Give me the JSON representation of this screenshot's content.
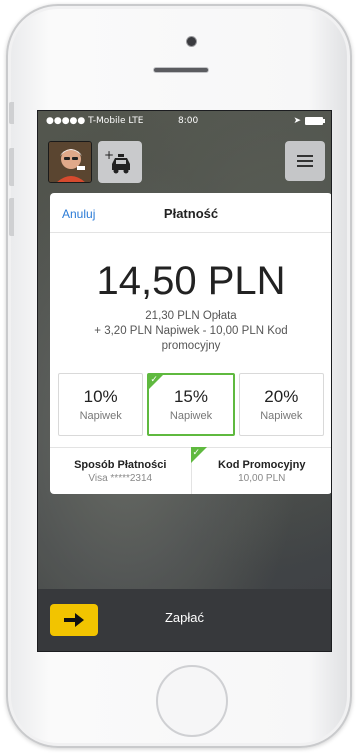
{
  "status_bar": {
    "carrier": "●●●●● T-Mobile LTE",
    "time": "8:00"
  },
  "header": {
    "avatar_icon": "driver-avatar",
    "taxi_icon": "add-taxi-icon",
    "menu_icon": "hamburger-menu-icon"
  },
  "payment_sheet": {
    "cancel_label": "Anuluj",
    "title": "Płatność",
    "total_amount": "14,50 PLN",
    "breakdown_line1": "21,30 PLN Opłata",
    "breakdown_line2": "+ 3,20 PLN Napiwek - 10,00 PLN Kod",
    "breakdown_line3": "promocyjny",
    "tips": [
      {
        "percent": "10%",
        "label": "Napiwek",
        "selected": false
      },
      {
        "percent": "15%",
        "label": "Napiwek",
        "selected": true
      },
      {
        "percent": "20%",
        "label": "Napiwek",
        "selected": false
      }
    ],
    "payment_method": {
      "title": "Sposób Płatności",
      "value": "Visa *****2314"
    },
    "promo_code": {
      "title": "Kod Promocyjny",
      "value": "10,00 PLN"
    }
  },
  "bottom_bar": {
    "pay_label": "Zapłać",
    "arrow_icon": "arrow-right-icon"
  },
  "colors": {
    "accent_blue": "#2b7bd6",
    "selected_green": "#5fb93f",
    "pay_yellow": "#f2c400",
    "bar_dark": "#37393c"
  }
}
